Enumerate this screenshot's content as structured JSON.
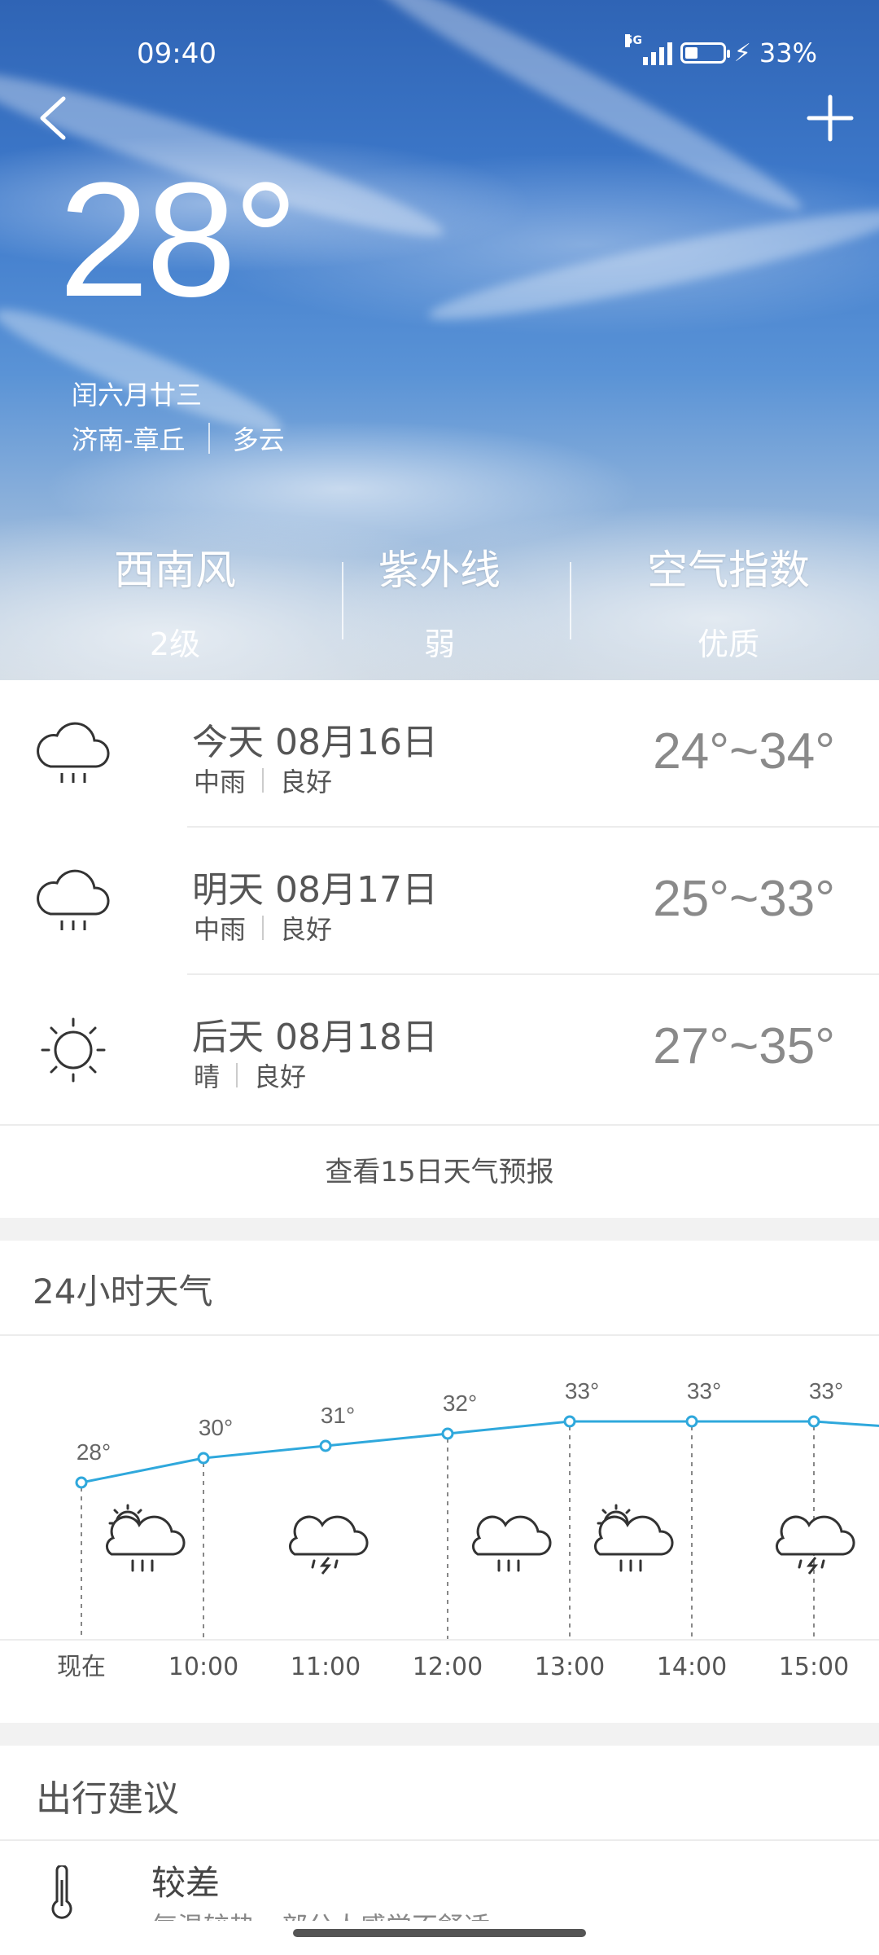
{
  "status_bar": {
    "time": "09:40",
    "network": "5G",
    "battery": "33%",
    "battery_level": 0.33,
    "charging": true
  },
  "header": {
    "back_icon": "chevron-left-icon",
    "add_icon": "plus-icon"
  },
  "current": {
    "temperature": "28°",
    "lunar_date": "闰六月廿三",
    "location": "济南-章丘",
    "condition": "多云",
    "stats": [
      {
        "label": "西南风",
        "value": "2级"
      },
      {
        "label": "紫外线",
        "value": "弱"
      },
      {
        "label": "空气指数",
        "value": "优质"
      }
    ]
  },
  "forecast": [
    {
      "date": "今天 08月16日",
      "condition": "中雨",
      "air": "良好",
      "range": "24°~34°",
      "icon": "rain-icon"
    },
    {
      "date": "明天 08月17日",
      "condition": "中雨",
      "air": "良好",
      "range": "25°~33°",
      "icon": "rain-icon"
    },
    {
      "date": "后天 08月18日",
      "condition": "晴",
      "air": "良好",
      "range": "27°~35°",
      "icon": "sun-icon"
    }
  ],
  "more_forecast": "查看15日天气预报",
  "hourly": {
    "title": "24小时天气",
    "line_color": "#2fa8dc",
    "chart_data": {
      "type": "line",
      "x": [
        "现在",
        "10:00",
        "11:00",
        "12:00",
        "13:00",
        "14:00",
        "15:00"
      ],
      "series": [
        {
          "values": [
            28,
            30,
            31,
            32,
            33,
            33,
            33
          ]
        }
      ],
      "labels": [
        "28°",
        "30°",
        "31°",
        "32°",
        "33°",
        "33°",
        "33°"
      ],
      "icons": [
        "partly-cloudy-rain-icon",
        "thunderstorm-icon",
        "rain-icon",
        "partly-cloudy-rain-icon",
        "thunderstorm-icon"
      ],
      "icon_slots": [
        0.5,
        2,
        3.5,
        4.5,
        6
      ]
    }
  },
  "travel": {
    "title": "出行建议",
    "level": "较差",
    "description": "气温较热，部分人感觉不舒适",
    "icon": "thermometer-icon"
  }
}
